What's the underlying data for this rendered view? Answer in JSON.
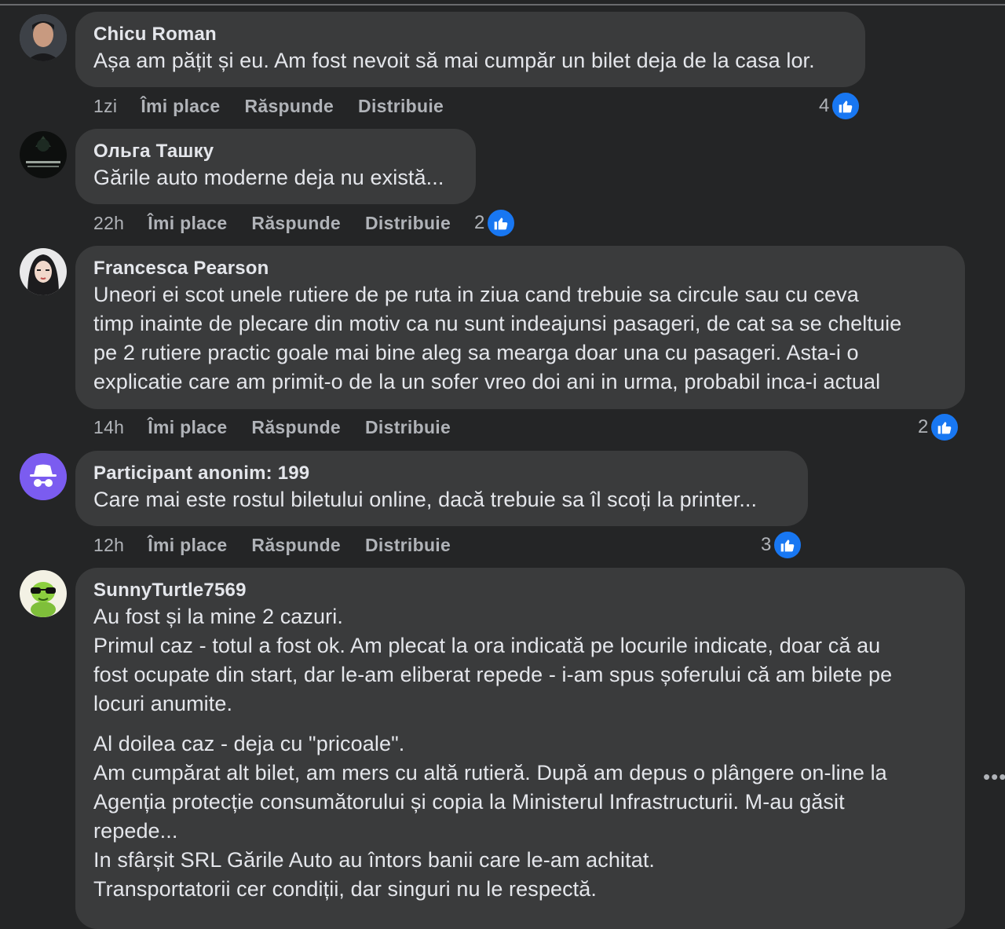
{
  "comments": [
    {
      "author": "Chicu Roman",
      "paragraphs": [
        "Așa am pățit și eu. Am fost nevoit să mai cumpăr un bilet deja de la casa lor."
      ],
      "age": "1zi",
      "likes": "4"
    },
    {
      "author": "Ольга Ташку",
      "paragraphs": [
        "Gările auto moderne deja nu există..."
      ],
      "age": "22h",
      "likes": "2"
    },
    {
      "author": "Francesca Pearson",
      "paragraphs": [
        "Uneori ei scot unele rutiere de pe ruta in ziua cand trebuie sa circule sau cu ceva\ntimp inainte de plecare din motiv ca nu sunt indeajunsi pasageri, de cat sa se cheltuie\npe 2 rutiere practic goale mai bine aleg sa mearga doar una cu pasageri. Asta-i o\nexplicatie care am primit-o de la un sofer vreo doi ani in urma, probabil inca-i actual"
      ],
      "age": "14h",
      "likes": "2"
    },
    {
      "author": "Participant anonim: 199",
      "paragraphs": [
        "Care mai este rostul biletului online, dacă trebuie sa îl scoți la printer..."
      ],
      "age": "12h",
      "likes": "3"
    },
    {
      "author": "SunnyTurtle7569",
      "paragraphs": [
        "Au fost și la mine 2 cazuri.\nPrimul caz - totul a fost ok. Am plecat la ora indicată pe locurile indicate, doar că au\nfost ocupate din start, dar le-am eliberat repede - i-am spus șoferului că am bilete pe\nlocuri anumite.",
        "Al doilea caz - deja cu \"pricoale\".\nAm cumpărat alt bilet, am mers cu altă rutieră. După am depus o plângere on-line la\nAgenția protecție consumătorului și copia la Ministerul Infrastructurii. M-au găsit\nrepede...\nIn sfârșit SRL Gările Auto au întors banii care le-am achitat.\nTransportatorii cer condiții, dar singuri nu le respectă."
      ]
    }
  ],
  "labels": {
    "like": "Îmi place",
    "reply": "Răspunde",
    "share": "Distribuie"
  },
  "colors": {
    "background": "#242526",
    "bubble": "#3a3b3c",
    "like_blue": "#1877f2",
    "anon_avatar": "#7b5cf0"
  },
  "icons": [
    "thumbs-up-icon",
    "more-options-icon",
    "anonymous-icon"
  ]
}
